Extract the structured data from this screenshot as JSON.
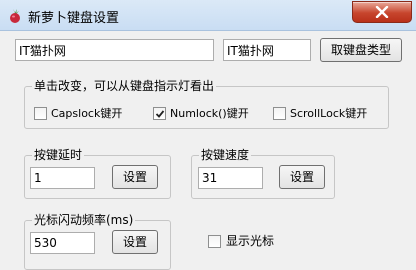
{
  "window": {
    "title": "新萝卜键盘设置"
  },
  "fields": {
    "name_left": "IT猫扑网",
    "name_right": "IT猫扑网"
  },
  "buttons": {
    "get_keyboard_type": "取键盘类型"
  },
  "indicator_group": {
    "label": "单击改变，可以从键盘指示灯看出",
    "capslock": {
      "label": "Capslock键开",
      "checked": false
    },
    "numlock": {
      "label": "Numlock()键开",
      "checked": true
    },
    "scrolllock": {
      "label": "ScrollLock键开",
      "checked": false
    }
  },
  "key_delay": {
    "label": "按键延时",
    "value": "1",
    "button": "设置"
  },
  "key_speed": {
    "label": "按键速度",
    "value": "31",
    "button": "设置"
  },
  "cursor_blink": {
    "label": "光标闪动频率(ms)",
    "value": "530",
    "button": "设置"
  },
  "show_cursor": {
    "label": "显示光标",
    "checked": false
  }
}
